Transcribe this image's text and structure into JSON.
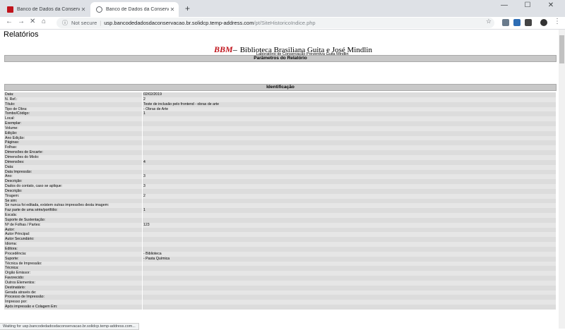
{
  "browser": {
    "tabs": [
      {
        "title": "Banco de Dados da Conservação",
        "active": false
      },
      {
        "title": "Banco de Dados da Conservação",
        "active": true
      }
    ],
    "not_secure": "Not secure",
    "url_host": "usp.bancodedadosdaconservacao.br.solidcp.temp-address.com",
    "url_path": "/pt/SiteHistoricoIndice.php",
    "status_text": "Waiting for usp.bancodedadosdaconservacao.br.solidcp.temp-address.com..."
  },
  "page": {
    "title": "Relatórios",
    "brand_bbm": "BBM",
    "brand_name": "Biblioteca Brasiliana Guita e José Mindlin",
    "brand_sub": "Laboratório de Conservação Preventiva Guita Mindlin",
    "params_header": "Parâmetros do Relatório",
    "ident_header": "Identificação",
    "rows": [
      {
        "label": "Data:",
        "value": "02/02/2019"
      },
      {
        "label": "N. Ref.:",
        "value": "2"
      },
      {
        "label": "Título:",
        "value": "Teste de inclusão pelo frontend - obras de arte"
      },
      {
        "label": "Tipo de Obra:",
        "value": "- Obras de Arte"
      },
      {
        "label": "Tombo/Código:",
        "value": "1"
      },
      {
        "label": "Local:",
        "value": ""
      },
      {
        "label": "Exemplar:",
        "value": ""
      },
      {
        "label": "Volume:",
        "value": ""
      },
      {
        "label": "Edição:",
        "value": ""
      },
      {
        "label": "Ano Edição:",
        "value": ""
      },
      {
        "label": "Páginas:",
        "value": ""
      },
      {
        "label": "Folhas:",
        "value": ""
      },
      {
        "label": "Dimensões de Encarte:",
        "value": ""
      },
      {
        "label": "Dimensões do Miolo:",
        "value": ""
      },
      {
        "label": "Dimensões:",
        "value": "4"
      },
      {
        "label": "Data:",
        "value": ""
      },
      {
        "label": "Data Impressão:",
        "value": ""
      },
      {
        "label": "Ano:",
        "value": "3"
      },
      {
        "label": "Descrição:",
        "value": ""
      },
      {
        "label": "Dados do contato, caso se aplique:",
        "value": "3"
      },
      {
        "label": "Descrição:",
        "value": ""
      },
      {
        "label": "Tiragem:",
        "value": "2"
      },
      {
        "label": "Se sim:",
        "value": ""
      },
      {
        "label": "Se nunca foi editada, existem outras impressões desta imagem:",
        "value": ""
      },
      {
        "label": "Faz parte de uma série/portfólio:",
        "value": "1"
      },
      {
        "label": "Escala:",
        "value": ""
      },
      {
        "label": "Suporte de Sustentação:",
        "value": ""
      },
      {
        "label": "Nº de Folhas / Partes:",
        "value": "123"
      },
      {
        "label": "Autor:",
        "value": ""
      },
      {
        "label": "Autor Principal:",
        "value": ""
      },
      {
        "label": "Autor Secundário:",
        "value": ""
      },
      {
        "label": "Idioma:",
        "value": ""
      },
      {
        "label": "Editora:",
        "value": ""
      },
      {
        "label": "Procedência:",
        "value": "- Biblioteca"
      },
      {
        "label": "Suporte:",
        "value": "- Pasta Química"
      },
      {
        "label": "Técnica de Impressão:",
        "value": ""
      },
      {
        "label": "Técnica:",
        "value": ""
      },
      {
        "label": "Órgão Emissor:",
        "value": ""
      },
      {
        "label": "Favorecido:",
        "value": ""
      },
      {
        "label": "Outros Elementos:",
        "value": ""
      },
      {
        "label": "Destinatário:",
        "value": ""
      },
      {
        "label": "Gerada através de:",
        "value": ""
      },
      {
        "label": "Processo de Impressão:",
        "value": ""
      },
      {
        "label": "Impresso por:",
        "value": ""
      },
      {
        "label": "Após impressão e Colagem Em:",
        "value": ""
      }
    ]
  },
  "colors": {
    "brand_red": "#c0141c",
    "bar_gray": "#c8c8c8"
  }
}
